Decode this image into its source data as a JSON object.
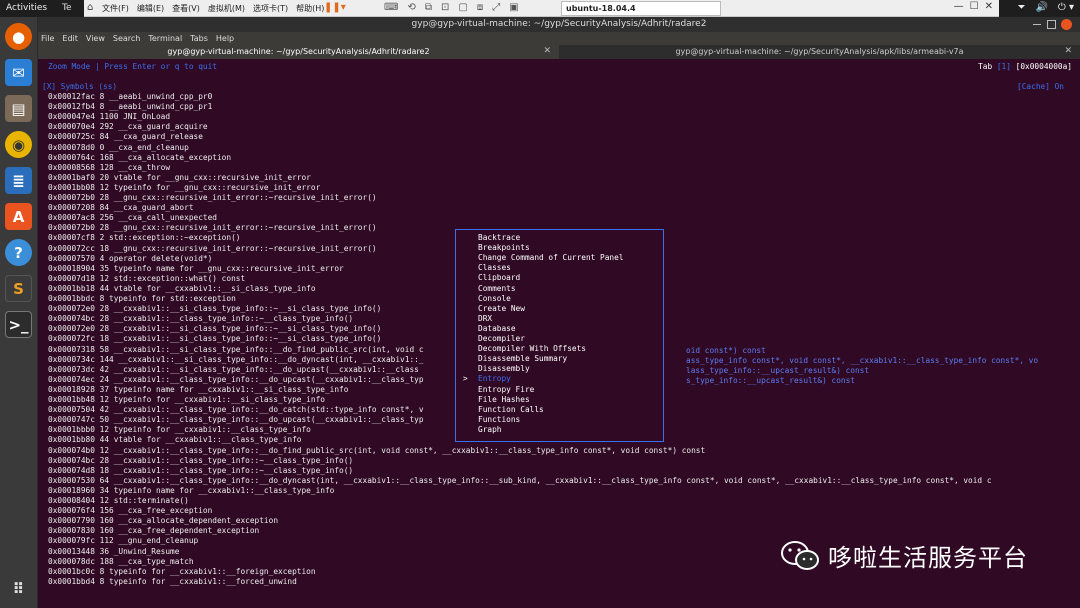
{
  "topbar": {
    "activities": "Activities",
    "tab": "Te",
    "tray": [
      "⏷",
      "🔊",
      "⏻ ▾"
    ]
  },
  "vmware": {
    "menus": [
      "文件(F)",
      "编辑(E)",
      "查看(V)",
      "虚拟机(M)",
      "选项卡(T)",
      "帮助(H)"
    ],
    "tab_label": "ubuntu-18.04.4",
    "tools": [
      "⟲",
      "⧉",
      "⊡",
      "▢",
      "⧈",
      "⤢",
      "▣",
      "▢",
      "⧠",
      "⤡"
    ]
  },
  "window": {
    "title": "gyp@gyp-virtual-machine: ~/gyp/SecurityAnalysis/Adhrit/radare2",
    "menu": [
      "File",
      "Edit",
      "View",
      "Search",
      "Terminal",
      "Tabs",
      "Help"
    ],
    "tabs": [
      "gyp@gyp-virtual-machine: ~/gyp/SecurityAnalysis/Adhrit/radare2",
      "gyp@gyp-virtual-machine: ~/gyp/SecurityAnalysis/apk/libs/armeabi-v7a"
    ]
  },
  "terminal": {
    "zoom_line": "Zoom Mode | Press Enter or q to quit",
    "tab_label": "Tab",
    "tab_index": "[1]",
    "address": "[0x0004000a]",
    "symbols_header": "[X] Symbols (ss)",
    "cache": "[Cache] On",
    "lines": [
      "0x00012fac 8 __aeabi_unwind_cpp_pr0",
      "0x00012fb4 8 __aeabi_unwind_cpp_pr1",
      "0x000047e4 1100 JNI_OnLoad",
      "0x000070e4 292 __cxa_guard_acquire",
      "0x0000725c 84 __cxa_guard_release",
      "0x000078d0 0 __cxa_end_cleanup",
      "0x0000764c 168 __cxa_allocate_exception",
      "0x00008568 128 __cxa_throw",
      "0x0001baf0 20 vtable for __gnu_cxx::recursive_init_error",
      "0x0001bb08 12 typeinfo for __gnu_cxx::recursive_init_error",
      "0x000072b0 28 __gnu_cxx::recursive_init_error::~recursive_init_error()",
      "0x00007208 84 __cxa_guard_abort",
      "0x00007ac8 256 __cxa_call_unexpected",
      "0x000072b0 28 __gnu_cxx::recursive_init_error::~recursive_init_error()",
      "0x00007cf8 2 std::exception::~exception()",
      "0x000072cc 18 __gnu_cxx::recursive_init_error::~recursive_init_error()",
      "0x00007570 4 operator delete(void*)",
      "0x00018904 35 typeinfo name for __gnu_cxx::recursive_init_error",
      "0x00007d18 12 std::exception::what() const",
      "0x0001bb18 44 vtable for __cxxabiv1::__si_class_type_info",
      "0x0001bbdc 8 typeinfo for std::exception",
      "0x000072e0 28 __cxxabiv1::__si_class_type_info::~__si_class_type_info()",
      "0x000074bc 28 __cxxabiv1::__class_type_info::~__class_type_info()",
      "0x000072e0 28 __cxxabiv1::__si_class_type_info::~__si_class_type_info()",
      "0x000072fc 18 __cxxabiv1::__si_class_type_info::~__si_class_type_info()",
      "0x00007318 58 __cxxabiv1::__si_class_type_info::__do_find_public_src(int, void c",
      "0x0000734c 144 __cxxabiv1::__si_class_type_info::__do_dyncast(int, __cxxabiv1::_",
      "0x000073dc 42 __cxxabiv1::__si_class_type_info::__do_upcast(__cxxabiv1::__class",
      "0x000074ec 24 __cxxabiv1::__class_type_info::__do_upcast(__cxxabiv1::__class_typ",
      "0x00018928 37 typeinfo name for __cxxabiv1::__si_class_type_info",
      "0x0001bb48 12 typeinfo for __cxxabiv1::__si_class_type_info",
      "0x00007504 42 __cxxabiv1::__class_type_info::__do_catch(std::type_info const*, v",
      "0x0000747c 50 __cxxabiv1::__class_type_info::__do_upcast(__cxxabiv1::__class_typ",
      "0x0001bbb0 12 typeinfo for __cxxabiv1::__class_type_info",
      "0x0001bb80 44 vtable for __cxxabiv1::__class_type_info",
      "0x000074b0 12 __cxxabiv1::__class_type_info::__do_find_public_src(int, void const*, __cxxabiv1::__class_type_info const*, void const*) const",
      "0x000074bc 28 __cxxabiv1::__class_type_info::~__class_type_info()",
      "0x000074d8 18 __cxxabiv1::__class_type_info::~__class_type_info()",
      "0x00007530 64 __cxxabiv1::__class_type_info::__do_dyncast(int, __cxxabiv1::__class_type_info::__sub_kind, __cxxabiv1::__class_type_info const*, void const*, __cxxabiv1::__class_type_info const*, void c",
      "0x00018960 34 typeinfo name for __cxxabiv1::__class_type_info",
      "0x00008404 12 std::terminate()",
      "0x000076f4 156 __cxa_free_exception",
      "0x00007790 160 __cxa_allocate_dependent_exception",
      "0x00007830 160 __cxa_free_dependent_exception",
      "0x000079fc 112 __gnu_end_cleanup",
      "0x00013448 36 _Unwind_Resume",
      "0x000078dc 188 __cxa_type_match",
      "0x0001bc0c 8 typeinfo for __cxxabiv1::__foreign_exception",
      "0x0001bbd4 8 typeinfo for __cxxabiv1::__forced_unwind"
    ],
    "overflow": [
      "oid const*) const",
      "ass_type_info const*, void const*, __cxxabiv1::__class_type_info const*, vo",
      "lass_type_info::__upcast_result&) const",
      "s_type_info::__upcast_result&) const"
    ]
  },
  "popup": {
    "items": [
      "Backtrace",
      "Breakpoints",
      "Change Command of Current Panel",
      "Classes",
      "Clipboard",
      "Comments",
      "Console",
      "Create New",
      "DRX",
      "Database",
      "Decompiler",
      "Decompiler With Offsets",
      "Disassemble Summary",
      "Disassembly",
      "Entropy",
      "Entropy Fire",
      "File Hashes",
      "Function Calls",
      "Functions",
      "Graph"
    ],
    "selected_index": 14,
    "cursor": ">"
  },
  "watermark": {
    "text": "哆啦生活服务平台"
  },
  "colors": {
    "terminal_bg": "#300a24",
    "accent_blue": "#3b6ff0",
    "ubuntu_orange": "#e95420"
  }
}
